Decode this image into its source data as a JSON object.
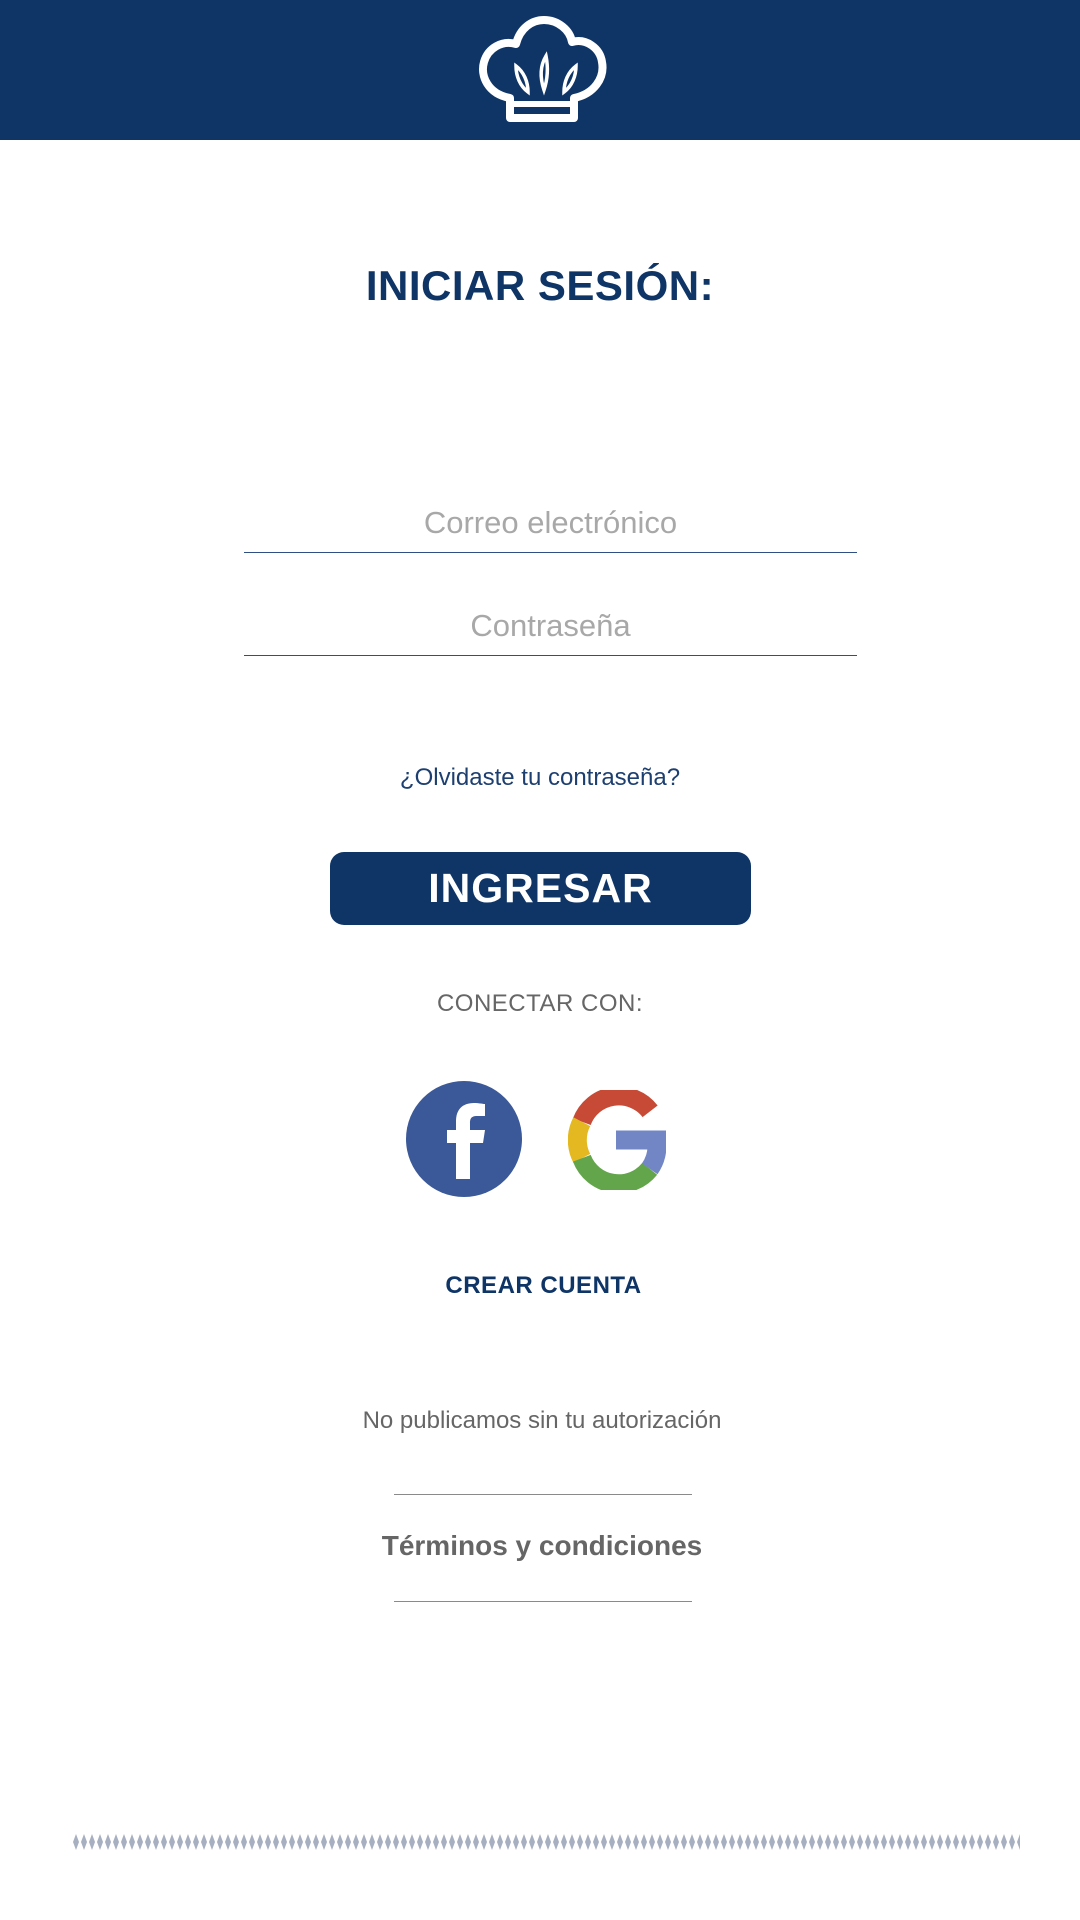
{
  "header": {
    "logo_icon": "chef-hat-icon",
    "background_color": "#0f3567"
  },
  "login": {
    "title": "INICIAR SESIÓN:",
    "email_placeholder": "Correo electrónico",
    "password_placeholder": "Contraseña",
    "forgot_password": "¿Olvidaste tu contraseña?",
    "submit_label": "INGRESAR"
  },
  "social": {
    "label": "CONECTAR CON:",
    "providers": [
      {
        "name": "facebook",
        "icon": "facebook-icon",
        "color": "#3b5998"
      },
      {
        "name": "google",
        "icon": "google-icon",
        "colors": [
          "#c64a35",
          "#e4b820",
          "#63a54a",
          "#7286c6"
        ]
      }
    ]
  },
  "footer": {
    "create_account": "CREAR CUENTA",
    "privacy_notice": "No publicamos sin tu autorización",
    "terms": "Términos y condiciones"
  },
  "colors": {
    "primary": "#0f3567",
    "text_muted": "#666666",
    "placeholder": "#a8a8a8"
  }
}
